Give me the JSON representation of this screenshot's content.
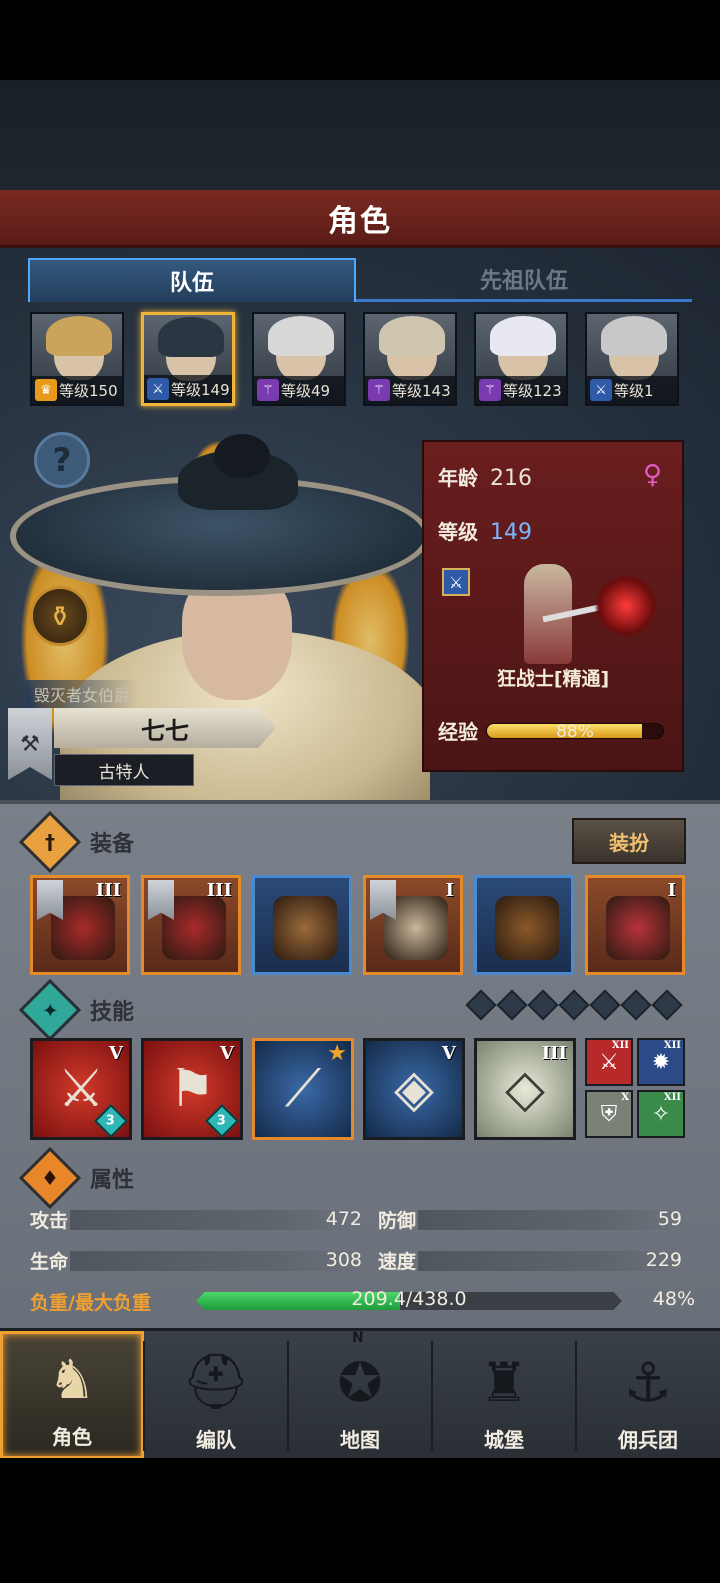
{
  "header": {
    "title": "角色"
  },
  "tabs": [
    {
      "label": "队伍",
      "active": true
    },
    {
      "label": "先祖队伍",
      "active": false
    }
  ],
  "roster": [
    {
      "level": "等级150",
      "class_icon": "shield-crest-icon",
      "class_color": "#e89a1c",
      "hair": "#c9a45a",
      "selected": false
    },
    {
      "level": "等级149",
      "class_icon": "sword-icon",
      "class_color": "#2f5aa8",
      "hair": "#2a3642",
      "selected": true
    },
    {
      "level": "等级49",
      "class_icon": "staff-icon",
      "class_color": "#7a3ab0",
      "hair": "#d8d8d8",
      "selected": false
    },
    {
      "level": "等级143",
      "class_icon": "staff-icon",
      "class_color": "#7a3ab0",
      "hair": "#cfc6b0",
      "selected": false
    },
    {
      "level": "等级123",
      "class_icon": "staff-icon",
      "class_color": "#7a3ab0",
      "hair": "#e8e8f0",
      "selected": false
    },
    {
      "level": "等级1",
      "class_icon": "sword-icon",
      "class_color": "#2f5aa8",
      "hair": "#c8c8c8",
      "selected": false
    }
  ],
  "hero": {
    "title": "毁灭者女伯爵",
    "name": "七七",
    "race": "古特人",
    "age_label": "年龄",
    "age": "216",
    "level_label": "等级",
    "level": "149",
    "gender_symbol": "♀",
    "class_name": "狂战士[精通]",
    "exp_label": "经验",
    "exp_text": "88%",
    "exp_fraction": 0.88
  },
  "equipment": {
    "label": "装备",
    "dress_button": "装扮",
    "items": [
      {
        "tier": "III",
        "rarity": "orange",
        "banner": true,
        "art_color": "#a82a2a"
      },
      {
        "tier": "III",
        "rarity": "orange",
        "banner": true,
        "art_color": "#a82a2a"
      },
      {
        "tier": "",
        "rarity": "blue",
        "banner": false,
        "art_color": "#9a6a3a"
      },
      {
        "tier": "I",
        "rarity": "orange",
        "banner": true,
        "art_color": "#c9b89a"
      },
      {
        "tier": "",
        "rarity": "blue",
        "banner": false,
        "art_color": "#8a5a2a"
      },
      {
        "tier": "I",
        "rarity": "orange",
        "banner": false,
        "art_color": "#b8323a"
      }
    ]
  },
  "skills": {
    "label": "技能",
    "slots_total": 7,
    "items": [
      {
        "tier": "V",
        "style": "red",
        "symbol": "⚔",
        "badge": "3",
        "star": false
      },
      {
        "tier": "V",
        "style": "red",
        "symbol": "⚑",
        "badge": "3",
        "star": false
      },
      {
        "tier": "",
        "style": "blue-or",
        "symbol": "⟋",
        "badge": "",
        "star": true
      },
      {
        "tier": "V",
        "style": "blue",
        "symbol": "◈",
        "badge": "",
        "star": false
      },
      {
        "tier": "III",
        "style": "white",
        "symbol": "◇",
        "badge": "",
        "star": false
      }
    ],
    "passives": [
      {
        "tier": "XII",
        "color": "#b82a2a",
        "symbol": "⚔"
      },
      {
        "tier": "XII",
        "color": "#2a4a88",
        "symbol": "✹"
      },
      {
        "tier": "X",
        "color": "#7a8278",
        "symbol": "⛨"
      },
      {
        "tier": "XII",
        "color": "#3a8a4a",
        "symbol": "✧"
      }
    ]
  },
  "attributes": {
    "label": "属性",
    "attack_label": "攻击",
    "attack": "472",
    "defense_label": "防御",
    "defense": "59",
    "hp_label": "生命",
    "hp": "308",
    "speed_label": "速度",
    "speed": "229",
    "load_label": "负重/最大负重",
    "load_text": "209.4/438.0",
    "load_pct": "48%",
    "load_fraction": 0.478
  },
  "nav": [
    {
      "label": "角色",
      "icon": "knight-icon",
      "active": true
    },
    {
      "label": "编队",
      "icon": "helmet-icon",
      "active": false
    },
    {
      "label": "地图",
      "icon": "compass-icon",
      "active": false
    },
    {
      "label": "城堡",
      "icon": "castle-icon",
      "active": false
    },
    {
      "label": "佣兵团",
      "icon": "ship-icon",
      "active": false
    }
  ],
  "compass_letter": "N"
}
